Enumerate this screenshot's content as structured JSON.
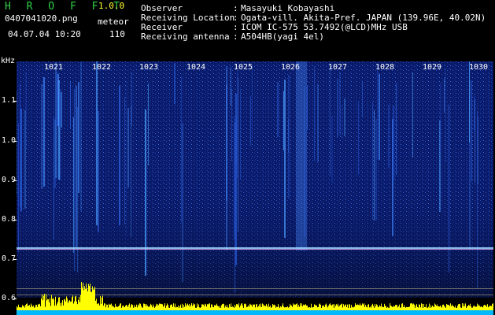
{
  "header": {
    "brand": "H R O F F T",
    "version": "1.0.0",
    "filename": "0407041020.png",
    "datetime": "04.07.04 10:20",
    "mode": "meteor",
    "count": "110"
  },
  "meta": [
    {
      "label": "Observer",
      "value": "Masayuki Kobayashi"
    },
    {
      "label": "Receiving Location",
      "value": "Ogata-vill. Akita-Pref. JAPAN (139.96E, 40.02N)"
    },
    {
      "label": "Receiver",
      "value": "ICOM IC-575 53.7492(@LCD)MHz USB"
    },
    {
      "label": "Receiving antenna",
      "value": "A504HB(yagi 4el)"
    }
  ],
  "separator": ":",
  "y_axis": {
    "unit": "kHz",
    "ticks": [
      "1.1",
      "1.0",
      "0.9",
      "0.8",
      "0.7",
      "0.6"
    ]
  },
  "x_axis": {
    "ticks": [
      "1021",
      "1022",
      "1023",
      "1024",
      "1025",
      "1026",
      "1027",
      "1028",
      "1029",
      "1030"
    ]
  },
  "colors": {
    "background": "#000000",
    "spectrum_base": "#0a1a6a",
    "carrier_line": "#9fd8ff",
    "activity_bars": "#ffff00",
    "baseline": "#00b8ff",
    "text_green": "#2fd24a",
    "text_yellow": "#ffff33",
    "text_white": "#ffffff"
  }
}
